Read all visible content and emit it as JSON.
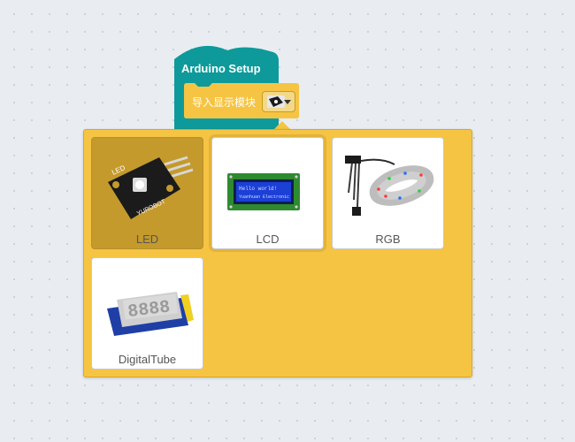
{
  "setup_block": {
    "title": "Arduino Setup",
    "color": "#0e9a9a"
  },
  "import_block": {
    "label": "导入显示模块",
    "color": "#f6c443"
  },
  "menu": {
    "options": [
      {
        "label": "LED",
        "image": "led-module-image",
        "selected": true
      },
      {
        "label": "LCD",
        "image": "lcd-module-image",
        "selected": false
      },
      {
        "label": "RGB",
        "image": "rgb-strip-image",
        "selected": false
      },
      {
        "label": "DigitalTube",
        "image": "digital-tube-image",
        "selected": false
      }
    ],
    "lcd_text": [
      "Hello world!",
      "Yuanhuan Electronic"
    ],
    "led_label": "LED",
    "led_brand": "YUROBOT",
    "tube_digits": "8888"
  }
}
